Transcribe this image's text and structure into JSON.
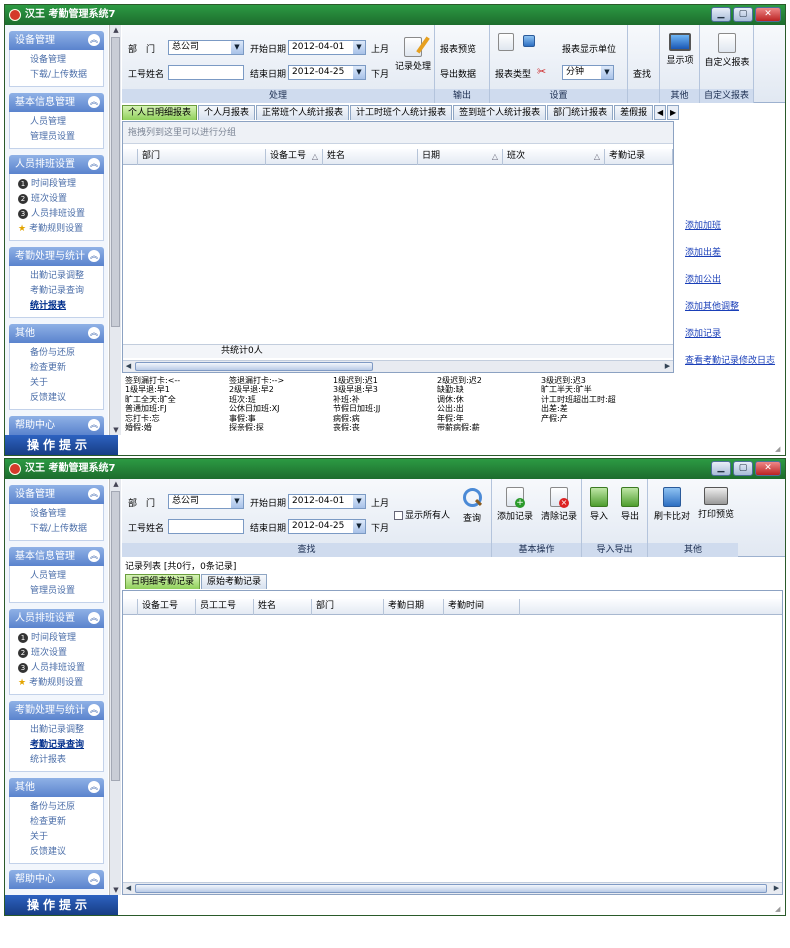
{
  "app": {
    "title": "汉王 考勤管理系统7"
  },
  "sidebar": {
    "groups": [
      {
        "title": "设备管理",
        "items": [
          "设备管理",
          "下载/上传数据"
        ]
      },
      {
        "title": "基本信息管理",
        "items": [
          "人员管理",
          "管理员设置"
        ]
      },
      {
        "title": "人员排班设置",
        "items": [
          "时间段管理",
          "班次设置",
          "人员排班设置",
          "考勤规则设置"
        ]
      },
      {
        "title": "考勤处理与统计",
        "items": [
          "出勤记录调整",
          "考勤记录查询",
          "统计报表"
        ]
      },
      {
        "title": "其他",
        "items": [
          "备份与还原",
          "检查更新",
          "关于",
          "反馈建议"
        ]
      },
      {
        "title": "帮助中心"
      }
    ],
    "tip": "操作提示"
  },
  "filter": {
    "dept_label": "部　门",
    "dept_value": "总公司",
    "name_label": "工号姓名",
    "name_value": "",
    "start_label": "开始日期",
    "start_value": "2012-04-01",
    "end_label": "结束日期",
    "end_value": "2012-04-25",
    "prev_month": "上月",
    "next_month": "下月"
  },
  "win1": {
    "ribbon": {
      "process": {
        "button": "记录处理",
        "caption": "处理"
      },
      "output": {
        "preview": "报表预览",
        "export": "导出数据",
        "caption": "输出"
      },
      "settings": {
        "report_type": "报表类型",
        "unit_label": "报表显示单位",
        "unit_value": "分钟",
        "caption": "设置"
      },
      "search": {
        "button": "查找"
      },
      "other": {
        "display": "显示项",
        "caption": "其他"
      },
      "custom": {
        "button": "自定义报表",
        "caption": "自定义报表"
      }
    },
    "tabs": [
      "个人日明细报表",
      "个人月报表",
      "正常班个人统计报表",
      "计工时班个人统计报表",
      "签到班个人统计报表",
      "部门统计报表",
      "差假报"
    ],
    "group_hint": "拖拽列到这里可以进行分组",
    "columns": [
      "部门",
      "设备工号",
      "姓名",
      "日期",
      "班次",
      "考勤记录"
    ],
    "footer": "共统计0人",
    "links": [
      "添加加班",
      "添加出差",
      "添加公出",
      "添加其他调整",
      "添加记录",
      "查看考勤记录修改日志"
    ],
    "legend": [
      [
        "签到漏打卡:<--",
        "1级早退:早1",
        "旷工全天:旷全",
        "普通加班:FJ",
        "忘打卡:忘",
        "婚假:婚"
      ],
      [
        "签退漏打卡:-->",
        "2级早退:早2",
        "班次:班",
        "公休日加班:XJ",
        "事假:事",
        "探亲假:探"
      ],
      [
        "1级迟到:迟1",
        "3级早退:早3",
        "补班:补",
        "节假日加班:JJ",
        "病假:病",
        "丧假:丧"
      ],
      [
        "2级迟到:迟2",
        "缺勤:缺",
        "调休:休",
        "公出:出",
        "年假:年",
        "带薪病假:薪"
      ],
      [
        "3级迟到:迟3",
        "旷工半天:旷半",
        "计工时班超出工时:超",
        "出差:差",
        "产假:产"
      ]
    ]
  },
  "win2": {
    "ribbon": {
      "show_all": "显示所有人",
      "query": "查询",
      "search_caption": "查找",
      "add": "添加记录",
      "clear": "清除记录",
      "basic_caption": "基本操作",
      "import": "导入",
      "export": "导出",
      "io_caption": "导入导出",
      "compare": "刷卡比对",
      "print": "打印预览",
      "other_caption": "其他"
    },
    "record_info": "记录列表 [共0行，0条记录]",
    "tabs": [
      "日明细考勤记录",
      "原始考勤记录"
    ],
    "columns": [
      "设备工号",
      "员工工号",
      "姓名",
      "部门",
      "考勤日期",
      "考勤时间"
    ]
  },
  "colors": {
    "title_bar": "#1d6c2d",
    "sidebar_header": "#5a83cd",
    "active_tab": "#8fd05a",
    "link": "#1a3fb8"
  }
}
